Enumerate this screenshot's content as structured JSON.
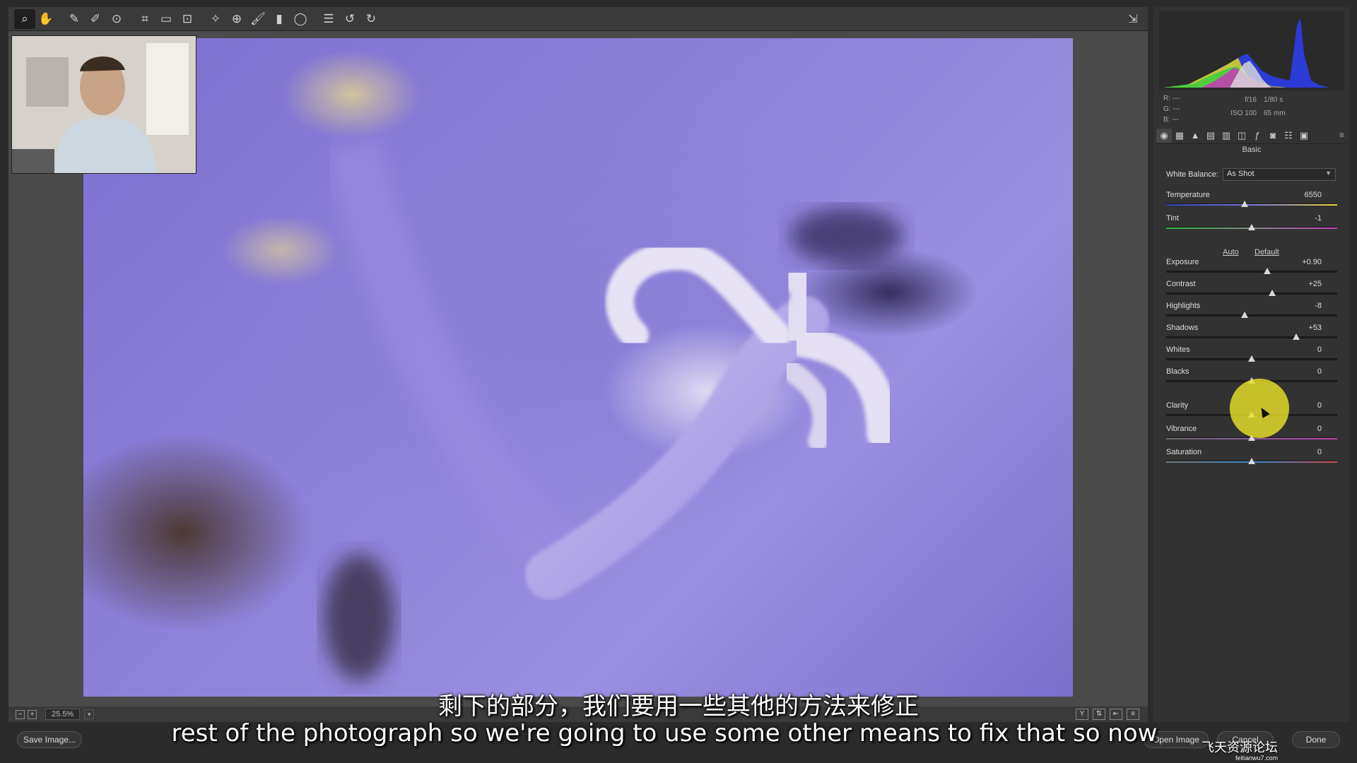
{
  "toolbar": {
    "tools": [
      "zoom-icon",
      "hand-icon",
      "white-balance-icon",
      "color-sampler-icon",
      "targeted-adjust-icon",
      "crop-icon",
      "straighten-icon",
      "transform-icon",
      "spot-removal-icon",
      "red-eye-icon",
      "adjustment-brush-icon",
      "graduated-filter-icon",
      "radial-filter-icon",
      "preferences-icon",
      "rotate-left-icon",
      "rotate-right-icon"
    ]
  },
  "histogram": {
    "rgb": {
      "r": "R:  ---",
      "g": "G:  ---",
      "b": "B:  ---"
    },
    "aperture": "f/16",
    "shutter": "1/80 s",
    "iso": "ISO 100",
    "focal": "65 mm"
  },
  "panel": {
    "title": "Basic",
    "tabs": [
      "basic-tab-icon",
      "tone-curve-icon",
      "detail-icon",
      "hsl-icon",
      "split-toning-icon",
      "lens-icon",
      "fx-icon",
      "camera-calibration-icon",
      "presets-icon",
      "snapshots-icon"
    ],
    "white_balance_label": "White Balance:",
    "white_balance_value": "As Shot",
    "auto": "Auto",
    "default": "Default",
    "sliders": [
      {
        "label": "Temperature",
        "value": "6550",
        "pos": 0.46
      },
      {
        "label": "Tint",
        "value": "-1",
        "pos": 0.5
      },
      {
        "label": "Exposure",
        "value": "+0.90",
        "pos": 0.59
      },
      {
        "label": "Contrast",
        "value": "+25",
        "pos": 0.62
      },
      {
        "label": "Highlights",
        "value": "-8",
        "pos": 0.46
      },
      {
        "label": "Shadows",
        "value": "+53",
        "pos": 0.76
      },
      {
        "label": "Whites",
        "value": "0",
        "pos": 0.5
      },
      {
        "label": "Blacks",
        "value": "0",
        "pos": 0.5
      },
      {
        "label": "Clarity",
        "value": "0",
        "pos": 0.5
      },
      {
        "label": "Vibrance",
        "value": "0",
        "pos": 0.5
      },
      {
        "label": "Saturation",
        "value": "0",
        "pos": 0.5
      }
    ]
  },
  "status": {
    "zoom": "25.5%",
    "zoom_out": "−",
    "zoom_in": "+"
  },
  "actions": {
    "save": "Save Image...",
    "open": "Open Image",
    "cancel": "Cancel",
    "done": "Done"
  },
  "subtitles": {
    "cn": "剩下的部分，我们要用一些其他的方法来修正",
    "en": "rest of the photograph so we're going to use some other means to fix that so now"
  },
  "watermark": {
    "text": "飞天资源论坛",
    "url": "feitianwu7.com"
  }
}
